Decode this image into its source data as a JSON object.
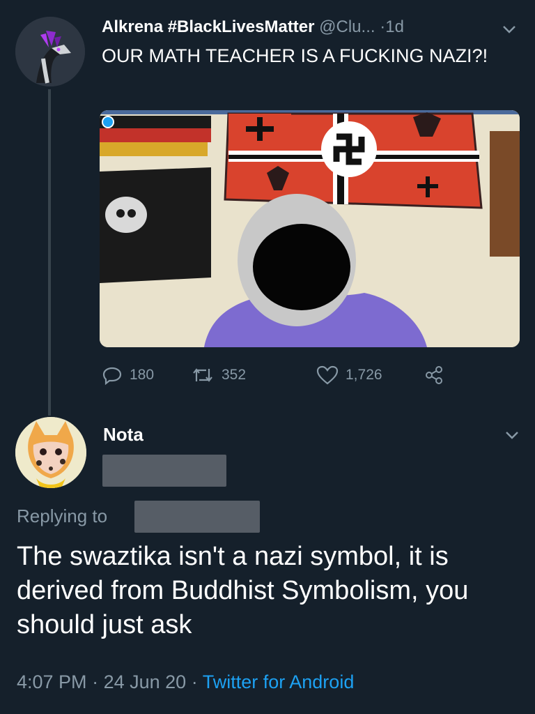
{
  "tweet": {
    "display_name": "Alkrena #BlackLivesMatter",
    "handle": "@Clu...",
    "separator": "·",
    "time_ago": "1d",
    "text": "OUR MATH TEACHER IS A FUCKING NAZI?!",
    "stats": {
      "replies": "180",
      "retweets": "352",
      "likes": "1,726"
    }
  },
  "reply": {
    "display_name": "Nota",
    "replying_label": "Replying to",
    "text": "The swaztika isn't a nazi symbol, it is derived from Buddhist Symbolism, you should just ask",
    "time": "4:07 PM",
    "date": "24 Jun 20",
    "client": "Twitter for Android",
    "separator": "·"
  },
  "icons": [
    "reply-icon",
    "retweet-icon",
    "like-icon",
    "share-icon",
    "chevron-down-icon"
  ],
  "colors": {
    "background": "#15202b",
    "muted": "#8899a6",
    "link": "#1da1f2",
    "redaction": "#565d66"
  }
}
